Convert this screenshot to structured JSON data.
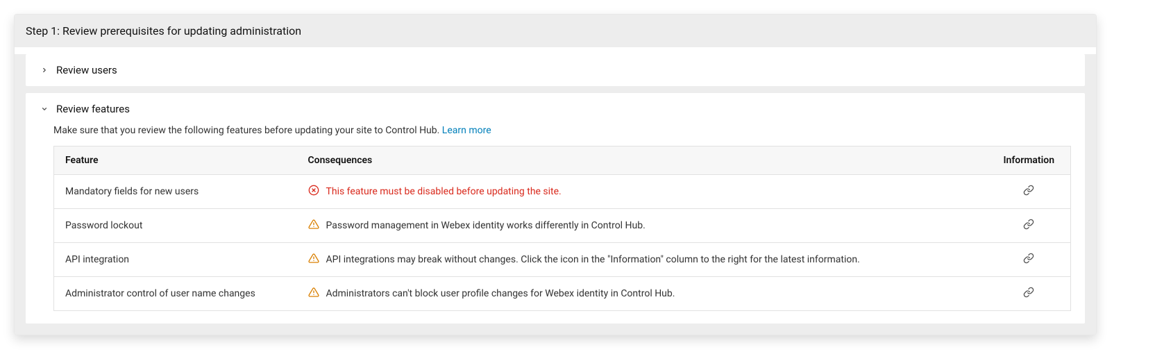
{
  "header": {
    "title": "Step 1: Review prerequisites for updating administration"
  },
  "sections": {
    "review_users": {
      "title": "Review users"
    },
    "review_features": {
      "title": "Review features",
      "intro_text": "Make sure that you review the following features before updating your site to Control Hub. ",
      "learn_more": "Learn more"
    }
  },
  "table": {
    "columns": {
      "feature": "Feature",
      "consequences": "Consequences",
      "information": "Information"
    },
    "rows": [
      {
        "feature": "Mandatory fields for new users",
        "severity": "error",
        "consequence": "This feature must be disabled before updating the site."
      },
      {
        "feature": "Password lockout",
        "severity": "warn",
        "consequence": "Password management in Webex identity works differently in Control Hub."
      },
      {
        "feature": "API integration",
        "severity": "warn",
        "consequence": "API integrations may break without changes. Click the icon in the \"Information\" column to the right for the latest information."
      },
      {
        "feature": "Administrator control of user name changes",
        "severity": "warn",
        "consequence": "Administrators can't block user profile changes for Webex identity in Control Hub."
      }
    ]
  }
}
